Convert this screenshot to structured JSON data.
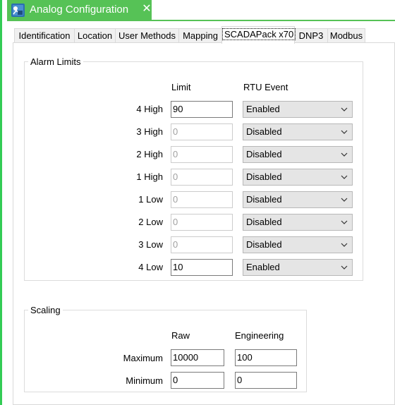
{
  "window": {
    "title": "Analog Configuration",
    "close_glyph": "✕",
    "accent_color": "#56c256"
  },
  "tabs": [
    {
      "label": "Identification",
      "active": false
    },
    {
      "label": "Location",
      "active": false
    },
    {
      "label": "User Methods",
      "active": false
    },
    {
      "label": "Mapping",
      "active": false
    },
    {
      "label": "SCADAPack x70",
      "active": true
    },
    {
      "label": "DNP3",
      "active": false
    },
    {
      "label": "Modbus",
      "active": false
    }
  ],
  "alarm_limits": {
    "title": "Alarm Limits",
    "col_limit": "Limit",
    "col_event": "RTU Event",
    "rows": [
      {
        "label": "4 High",
        "limit": "90",
        "limit_enabled": true,
        "event": "Enabled"
      },
      {
        "label": "3 High",
        "limit": "0",
        "limit_enabled": false,
        "event": "Disabled"
      },
      {
        "label": "2 High",
        "limit": "0",
        "limit_enabled": false,
        "event": "Disabled"
      },
      {
        "label": "1 High",
        "limit": "0",
        "limit_enabled": false,
        "event": "Disabled"
      },
      {
        "label": "1 Low",
        "limit": "0",
        "limit_enabled": false,
        "event": "Disabled"
      },
      {
        "label": "2 Low",
        "limit": "0",
        "limit_enabled": false,
        "event": "Disabled"
      },
      {
        "label": "3 Low",
        "limit": "0",
        "limit_enabled": false,
        "event": "Disabled"
      },
      {
        "label": "4 Low",
        "limit": "10",
        "limit_enabled": true,
        "event": "Enabled"
      }
    ]
  },
  "scaling": {
    "title": "Scaling",
    "col_raw": "Raw",
    "col_eng": "Engineering",
    "rows": [
      {
        "label": "Maximum",
        "raw": "10000",
        "eng": "100"
      },
      {
        "label": "Minimum",
        "raw": "0",
        "eng": "0"
      }
    ]
  }
}
